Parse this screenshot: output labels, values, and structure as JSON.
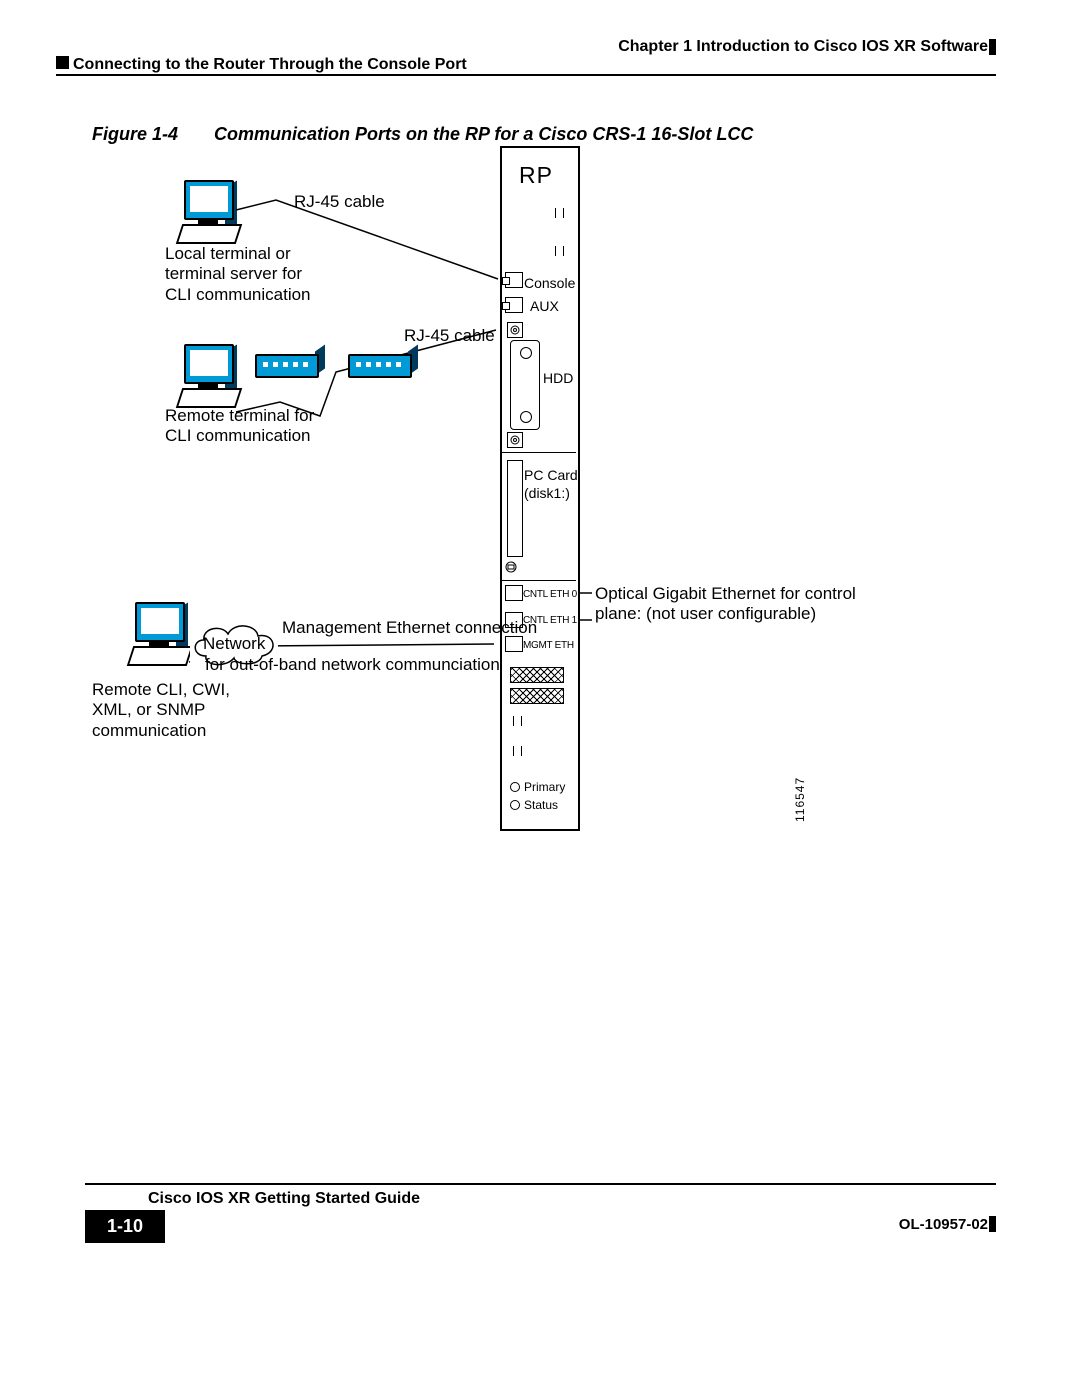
{
  "header": {
    "chapter": "Chapter 1      Introduction to Cisco IOS XR Software",
    "section": "Connecting to the Router Through the Console Port"
  },
  "figure": {
    "number": "Figure 1-4",
    "caption": "Communication Ports on the RP for a Cisco CRS-1 16-Slot LCC",
    "id": "116547"
  },
  "labels": {
    "rj45_top": "RJ-45 cable",
    "rj45_mid": "RJ-45 cable",
    "local_terminal": "Local terminal or\nterminal server for\nCLI communication",
    "remote_terminal": "Remote terminal for\nCLI communication",
    "mgmt_eth_line1": "Management Ethernet connection",
    "mgmt_eth_line2": "for out-of-band network communciation",
    "network": "Network",
    "remote_cli": "Remote CLI, CWI,\nXML, or SNMP\ncommunication",
    "optical_ge": "Optical Gigabit Ethernet for control\nplane: (not user configurable)"
  },
  "rp": {
    "title": "RP",
    "ports": {
      "console": "Console",
      "aux": "AUX",
      "hdd": "HDD",
      "pccard": "PC Card\n(disk1:)",
      "cntl0": "CNTL ETH 0",
      "cntl1": "CNTL ETH 1",
      "mgmt": "MGMT ETH",
      "primary": "Primary",
      "status": "Status"
    }
  },
  "footer": {
    "title": "Cisco IOS XR Getting Started Guide",
    "page": "1-10",
    "doc": "OL-10957-02"
  }
}
